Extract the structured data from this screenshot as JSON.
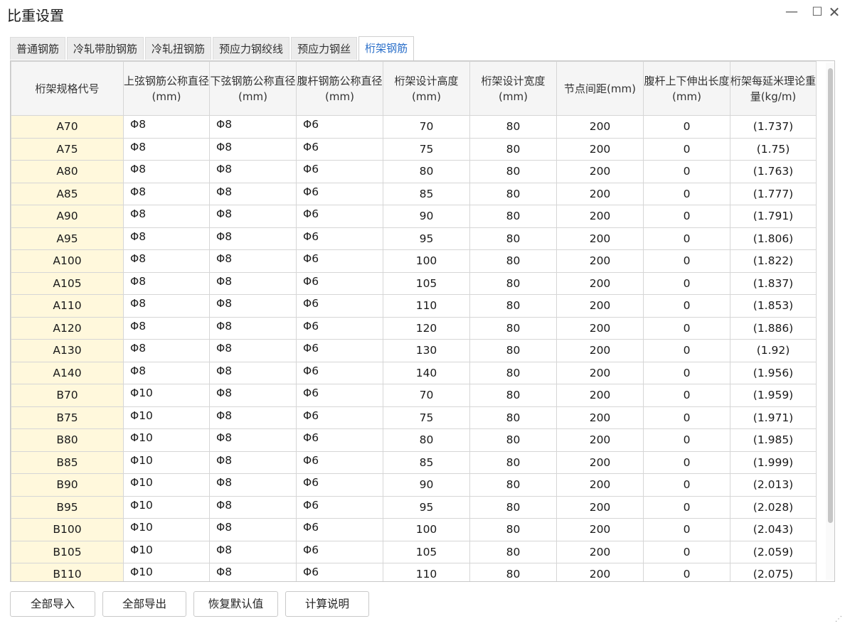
{
  "window": {
    "title": "比重设置",
    "minimize_glyph": "—",
    "maximize_glyph": "☐",
    "close_glyph": "✕"
  },
  "tabs": [
    {
      "label": "普通钢筋",
      "active": false
    },
    {
      "label": "冷轧带肋钢筋",
      "active": false
    },
    {
      "label": "冷轧扭钢筋",
      "active": false
    },
    {
      "label": "预应力钢绞线",
      "active": false
    },
    {
      "label": "预应力钢丝",
      "active": false
    },
    {
      "label": "桁架钢筋",
      "active": true
    }
  ],
  "table": {
    "columns": [
      "桁架规格代号",
      "上弦钢筋公称直径(mm)",
      "下弦钢筋公称直径(mm)",
      "腹杆钢筋公称直径(mm)",
      "桁架设计高度(mm)",
      "桁架设计宽度(mm)",
      "节点间距(mm)",
      "腹杆上下伸出长度(mm)",
      "桁架每延米理论重量(kg/m)"
    ],
    "rows": [
      [
        "A70",
        "Φ8",
        "Φ8",
        "Φ6",
        "70",
        "80",
        "200",
        "0",
        "(1.737)"
      ],
      [
        "A75",
        "Φ8",
        "Φ8",
        "Φ6",
        "75",
        "80",
        "200",
        "0",
        "(1.75)"
      ],
      [
        "A80",
        "Φ8",
        "Φ8",
        "Φ6",
        "80",
        "80",
        "200",
        "0",
        "(1.763)"
      ],
      [
        "A85",
        "Φ8",
        "Φ8",
        "Φ6",
        "85",
        "80",
        "200",
        "0",
        "(1.777)"
      ],
      [
        "A90",
        "Φ8",
        "Φ8",
        "Φ6",
        "90",
        "80",
        "200",
        "0",
        "(1.791)"
      ],
      [
        "A95",
        "Φ8",
        "Φ8",
        "Φ6",
        "95",
        "80",
        "200",
        "0",
        "(1.806)"
      ],
      [
        "A100",
        "Φ8",
        "Φ8",
        "Φ6",
        "100",
        "80",
        "200",
        "0",
        "(1.822)"
      ],
      [
        "A105",
        "Φ8",
        "Φ8",
        "Φ6",
        "105",
        "80",
        "200",
        "0",
        "(1.837)"
      ],
      [
        "A110",
        "Φ8",
        "Φ8",
        "Φ6",
        "110",
        "80",
        "200",
        "0",
        "(1.853)"
      ],
      [
        "A120",
        "Φ8",
        "Φ8",
        "Φ6",
        "120",
        "80",
        "200",
        "0",
        "(1.886)"
      ],
      [
        "A130",
        "Φ8",
        "Φ8",
        "Φ6",
        "130",
        "80",
        "200",
        "0",
        "(1.92)"
      ],
      [
        "A140",
        "Φ8",
        "Φ8",
        "Φ6",
        "140",
        "80",
        "200",
        "0",
        "(1.956)"
      ],
      [
        "B70",
        "Φ10",
        "Φ8",
        "Φ6",
        "70",
        "80",
        "200",
        "0",
        "(1.959)"
      ],
      [
        "B75",
        "Φ10",
        "Φ8",
        "Φ6",
        "75",
        "80",
        "200",
        "0",
        "(1.971)"
      ],
      [
        "B80",
        "Φ10",
        "Φ8",
        "Φ6",
        "80",
        "80",
        "200",
        "0",
        "(1.985)"
      ],
      [
        "B85",
        "Φ10",
        "Φ8",
        "Φ6",
        "85",
        "80",
        "200",
        "0",
        "(1.999)"
      ],
      [
        "B90",
        "Φ10",
        "Φ8",
        "Φ6",
        "90",
        "80",
        "200",
        "0",
        "(2.013)"
      ],
      [
        "B95",
        "Φ10",
        "Φ8",
        "Φ6",
        "95",
        "80",
        "200",
        "0",
        "(2.028)"
      ],
      [
        "B100",
        "Φ10",
        "Φ8",
        "Φ6",
        "100",
        "80",
        "200",
        "0",
        "(2.043)"
      ],
      [
        "B105",
        "Φ10",
        "Φ8",
        "Φ6",
        "105",
        "80",
        "200",
        "0",
        "(2.059)"
      ],
      [
        "B110",
        "Φ10",
        "Φ8",
        "Φ6",
        "110",
        "80",
        "200",
        "0",
        "(2.075)"
      ]
    ]
  },
  "buttons": {
    "import_all": "全部导入",
    "export_all": "全部导出",
    "restore_default": "恢复默认值",
    "calc_help": "计算说明"
  },
  "colors": {
    "active_tab_text": "#2a6fc9",
    "code_cell_bg": "#fff8dc"
  },
  "icons": {
    "minimize": "minimize-icon",
    "maximize": "maximize-icon",
    "close": "close-icon",
    "resize_grip": "resize-grip-icon"
  }
}
